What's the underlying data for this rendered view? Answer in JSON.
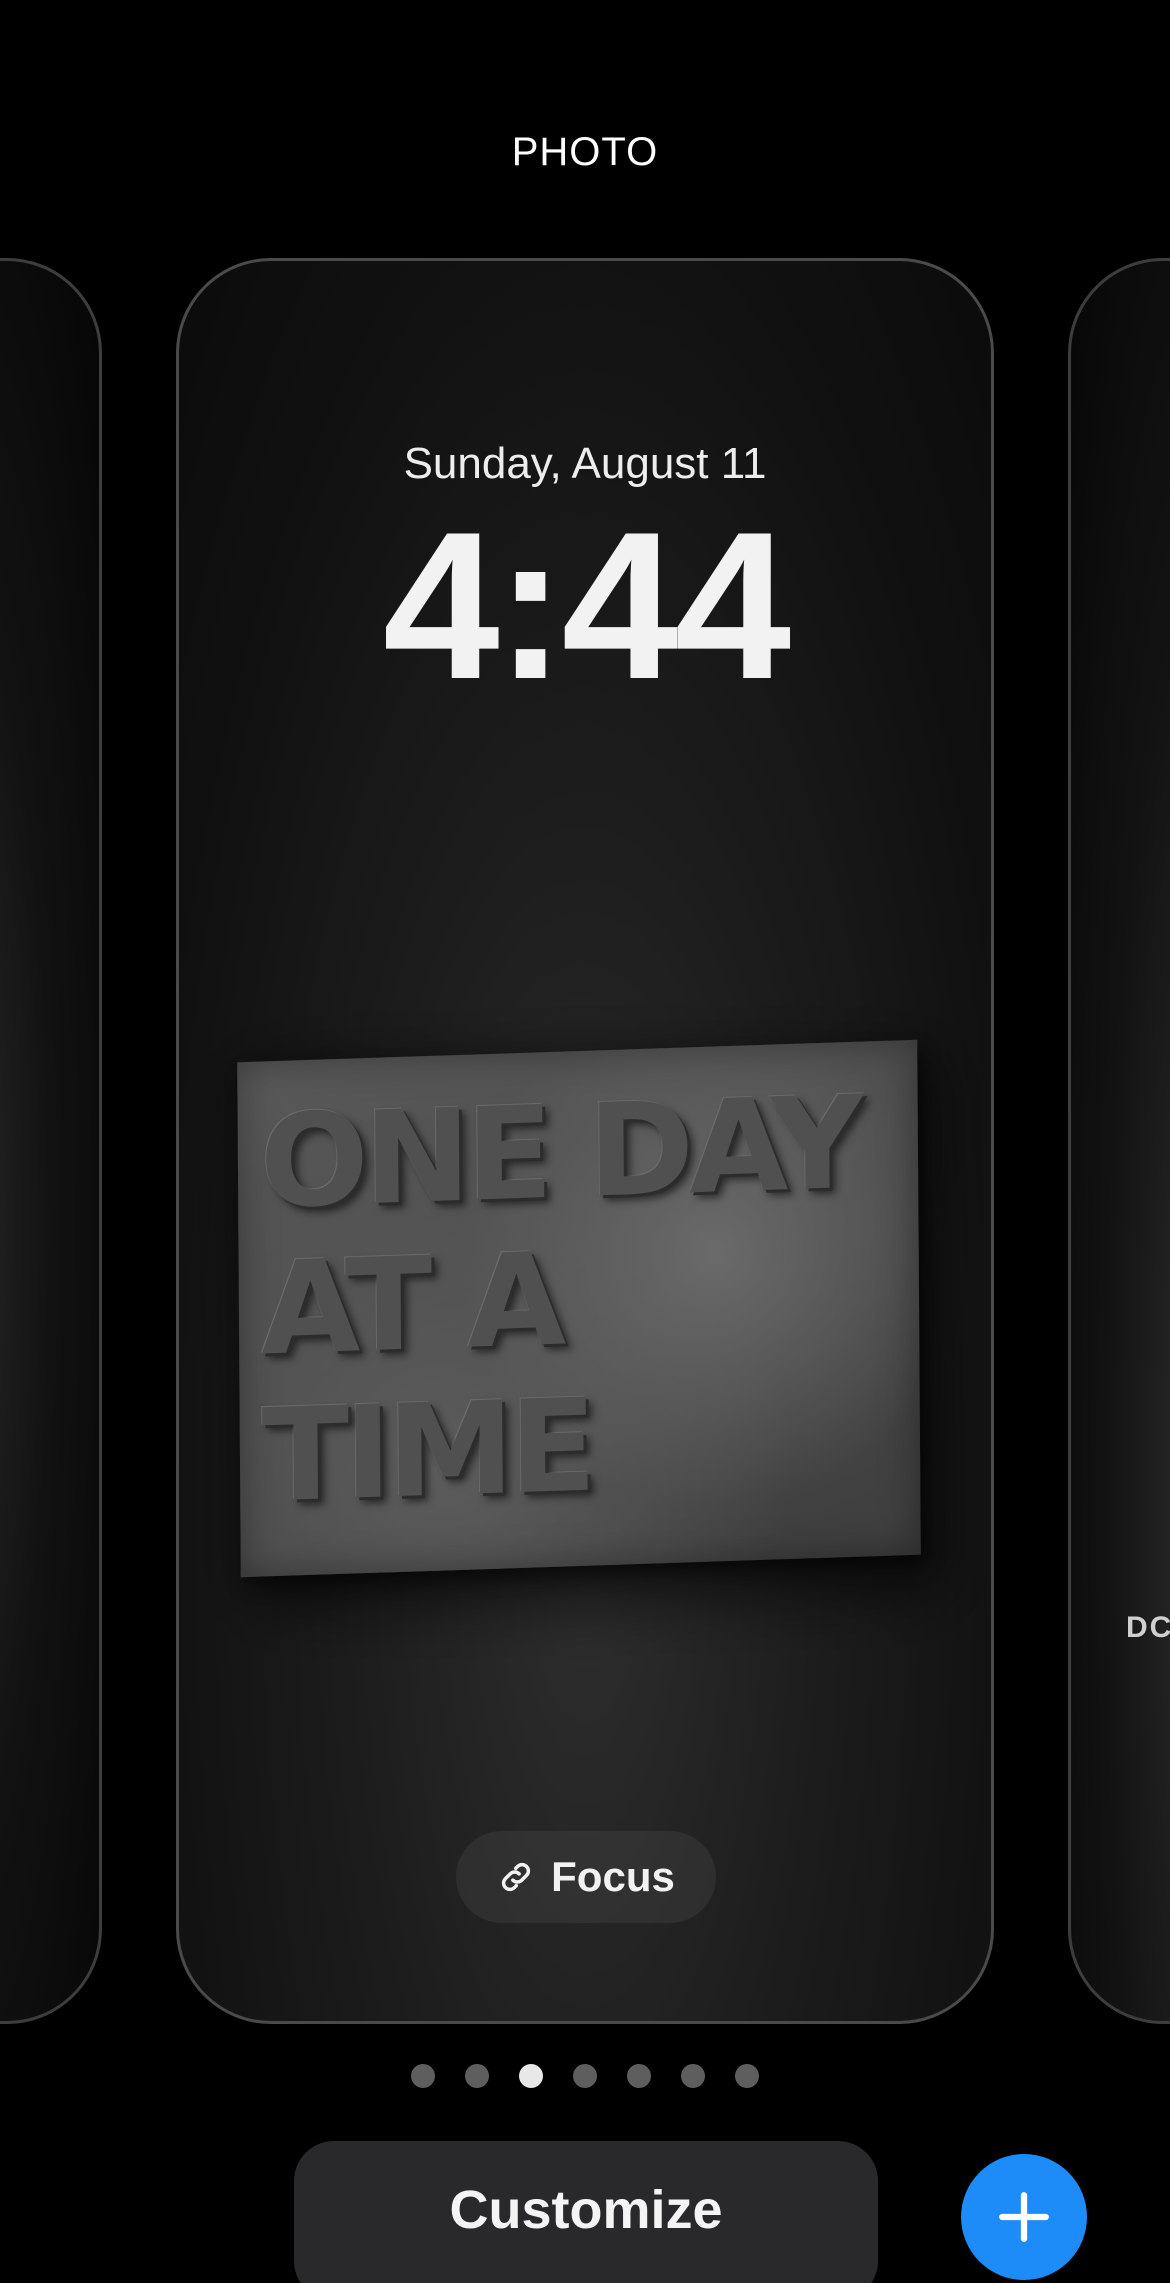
{
  "header": {
    "wallpaper_type": "PHOTO"
  },
  "lock_screen": {
    "date": "Sunday, August 11",
    "time": "4:44",
    "artwork_text": [
      "ONE DAY",
      "AT A",
      "TIME"
    ],
    "focus_label": "Focus"
  },
  "right_peek": {
    "text": "DC"
  },
  "pagination": {
    "total": 7,
    "active_index": 2
  },
  "actions": {
    "customize_label": "Customize",
    "add_icon": "plus-icon",
    "add_color": "#1d8cf8"
  }
}
